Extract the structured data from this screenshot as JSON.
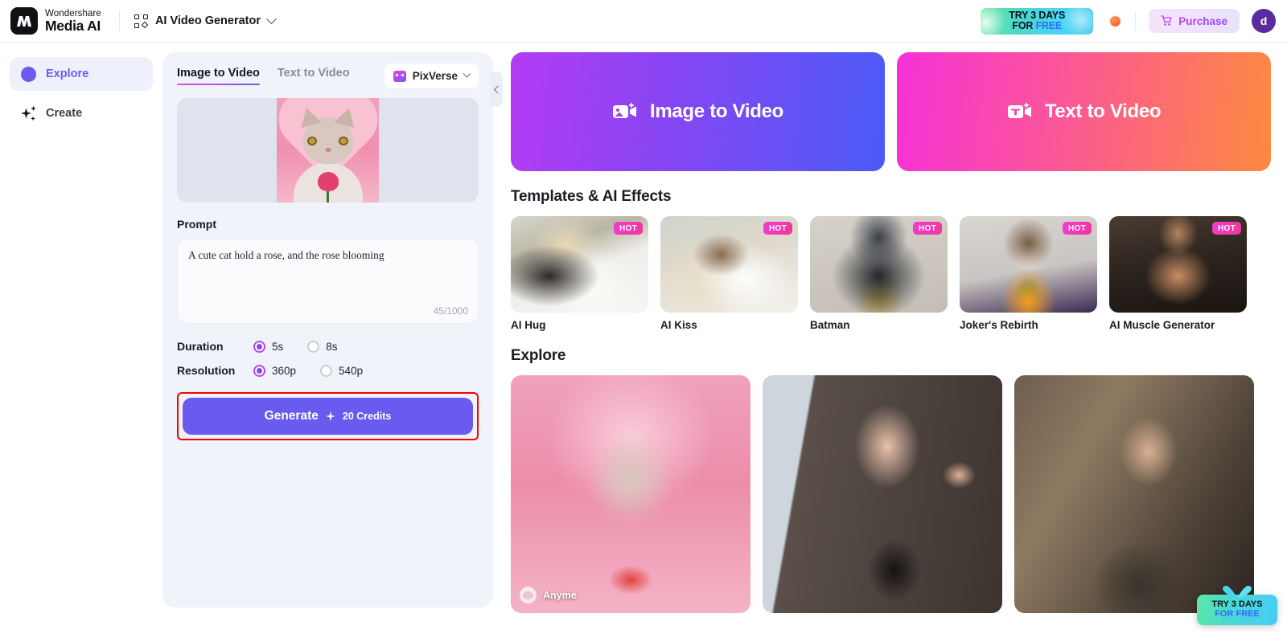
{
  "topbar": {
    "brand_top": "Wondershare",
    "brand_bottom": "Media AI",
    "brand_mark": "logo-icon",
    "app_switcher": {
      "label": "AI Video Generator",
      "icon": "grid-icon",
      "chevron": "chevron-down-icon"
    },
    "promo": {
      "line1": "TRY 3 DAYS",
      "line2_prefix": "FOR ",
      "line2_highlight": "FREE"
    },
    "notification": {
      "icon": "notification-dot-icon"
    },
    "purchase": {
      "label": "Purchase",
      "icon": "cart-icon"
    },
    "avatar": {
      "initial": "d"
    }
  },
  "sidebar": {
    "items": [
      {
        "label": "Explore",
        "icon": "compass-icon",
        "active": true
      },
      {
        "label": "Create",
        "icon": "sparkle-icon",
        "active": false
      }
    ]
  },
  "config": {
    "tabs": [
      {
        "label": "Image to Video",
        "active": true
      },
      {
        "label": "Text to Video",
        "active": false
      }
    ],
    "model": {
      "name": "PixVerse",
      "icon": "pixverse-icon",
      "chevron": "chevron-down-icon"
    },
    "image_preview": {
      "alt": "cat-with-rose-thumbnail"
    },
    "prompt": {
      "label": "Prompt",
      "value": "A cute cat hold a rose, and the rose blooming",
      "counter": "45/1000"
    },
    "duration": {
      "label": "Duration",
      "options": [
        {
          "label": "5s",
          "selected": true
        },
        {
          "label": "8s",
          "selected": false
        }
      ]
    },
    "resolution": {
      "label": "Resolution",
      "options": [
        {
          "label": "360p",
          "selected": true
        },
        {
          "label": "540p",
          "selected": false
        }
      ]
    },
    "generate": {
      "label": "Generate",
      "credits": "20 Credits",
      "icon": "sparkle-icon",
      "highlight_color": "#ff0000"
    },
    "collapse_handle": {
      "icon": "chevron-left-icon"
    }
  },
  "main": {
    "heroes": [
      {
        "label": "Image to Video",
        "icon": "image-video-icon",
        "accent": "#8b44f3"
      },
      {
        "label": "Text to Video",
        "icon": "text-video-icon",
        "accent": "#fb5a91"
      }
    ],
    "templates_section": {
      "title": "Templates & AI Effects",
      "items": [
        {
          "name": "AI Hug",
          "badge": "HOT"
        },
        {
          "name": "AI Kiss",
          "badge": "HOT"
        },
        {
          "name": "Batman",
          "badge": "HOT"
        },
        {
          "name": "Joker's Rebirth",
          "badge": "HOT"
        },
        {
          "name": "AI Muscle Generator",
          "badge": "HOT"
        }
      ]
    },
    "explore_section": {
      "title": "Explore",
      "items": [
        {
          "author": "Anyme",
          "alt": "cat-with-rose"
        },
        {
          "author": "",
          "alt": "woman-in-black-dress"
        },
        {
          "author": "",
          "alt": "man-with-sunglasses"
        }
      ]
    },
    "floating_promo": {
      "line1": "TRY 3 DAYS",
      "line2_prefix": "FOR ",
      "line2_highlight": "FREE"
    }
  }
}
